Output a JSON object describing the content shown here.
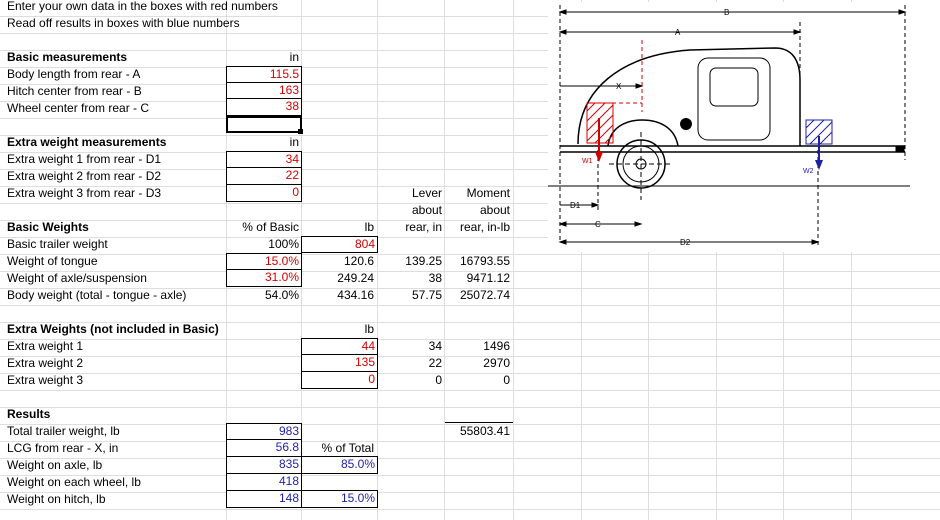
{
  "instructions": {
    "line1": "Enter your own data in the boxes with red numbers",
    "line2": "Read off results in boxes with blue numbers"
  },
  "basic_measurements": {
    "title": "Basic measurements",
    "unit": "in",
    "rows": [
      {
        "label": "Body length from rear - A",
        "value": "115.5"
      },
      {
        "label": "Hitch center from rear - B",
        "value": "163"
      },
      {
        "label": "Wheel center from rear - C",
        "value": "38"
      }
    ]
  },
  "extra_measurements": {
    "title": "Extra weight measurements",
    "unit": "in",
    "rows": [
      {
        "label": "Extra weight 1 from rear - D1",
        "value": "34"
      },
      {
        "label": "Extra weight 2 from rear - D2",
        "value": "22"
      },
      {
        "label": "Extra weight 3 from rear - D3",
        "value": "0"
      }
    ]
  },
  "lever_header": {
    "line1": "Lever",
    "line2": "about",
    "line3": "rear, in"
  },
  "moment_header": {
    "line1": "Moment",
    "line2": "about",
    "line3": "rear, in-lb"
  },
  "basic_weights": {
    "title": "Basic Weights",
    "pct_header": "% of Basic",
    "lb_header": "lb",
    "rows": [
      {
        "label": "Basic trailer weight",
        "pct": "100%",
        "lb": "804",
        "lever": "",
        "moment": ""
      },
      {
        "label": "Weight of tongue",
        "pct": "15.0%",
        "lb": "120.6",
        "lever": "139.25",
        "moment": "16793.55"
      },
      {
        "label": "Weight of axle/suspension",
        "pct": "31.0%",
        "lb": "249.24",
        "lever": "38",
        "moment": "9471.12"
      },
      {
        "label": "Body weight (total - tongue - axle)",
        "pct": "54.0%",
        "lb": "434.16",
        "lever": "57.75",
        "moment": "25072.74"
      }
    ]
  },
  "extra_weights": {
    "title": "Extra Weights (not included in Basic)",
    "lb_header": "lb",
    "rows": [
      {
        "label": "Extra weight 1",
        "lb": "44",
        "lever": "34",
        "moment": "1496"
      },
      {
        "label": "Extra weight 2",
        "lb": "135",
        "lever": "22",
        "moment": "2970"
      },
      {
        "label": "Extra weight 3",
        "lb": "0",
        "lever": "0",
        "moment": "0"
      }
    ]
  },
  "results": {
    "title": "Results",
    "total_moment": "55803.41",
    "pct_total_header": "% of Total",
    "rows": [
      {
        "label": "Total trailer weight, lb",
        "value": "983",
        "pct": ""
      },
      {
        "label": "LCG from rear - X, in",
        "value": "56.8",
        "pct": ""
      },
      {
        "label": "Weight on axle, lb",
        "value": "835",
        "pct": "85.0%"
      },
      {
        "label": "Weight on each wheel, lb",
        "value": "418",
        "pct": ""
      },
      {
        "label": "Weight on hitch, lb",
        "value": "148",
        "pct": "15.0%"
      }
    ]
  },
  "diagram": {
    "label_a": "A",
    "label_b": "B",
    "label_c": "C",
    "label_x": "X",
    "label_d1": "D1",
    "label_d2": "D2",
    "label_w1": "W1",
    "label_w2": "W2"
  },
  "colors": {
    "input": "#d40000",
    "output": "#1f1fa8"
  }
}
